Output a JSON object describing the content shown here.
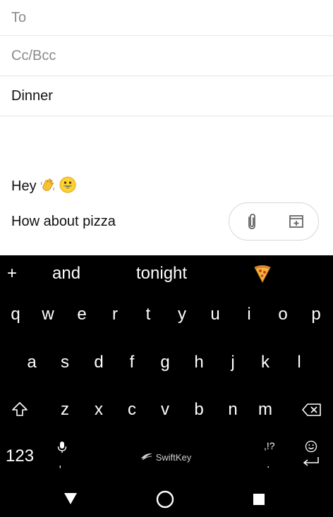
{
  "compose": {
    "to_placeholder": "To",
    "cc_placeholder": "Cc/Bcc",
    "subject": "Dinner",
    "body_line1": "Hey",
    "body_line2": "How about pizza"
  },
  "icons": {
    "wave": "waving-hand-emoji",
    "grin": "grinning-face-emoji",
    "attach": "paperclip-icon",
    "insert": "insert-box-icon",
    "pizza": "pizza-emoji"
  },
  "keyboard": {
    "plus": "+",
    "suggestions": [
      "and",
      "tonight"
    ],
    "row1": [
      "q",
      "w",
      "e",
      "r",
      "t",
      "y",
      "u",
      "i",
      "o",
      "p"
    ],
    "row2": [
      "a",
      "s",
      "d",
      "f",
      "g",
      "h",
      "j",
      "k",
      "l"
    ],
    "row3": [
      "z",
      "x",
      "c",
      "v",
      "b",
      "n",
      "m"
    ],
    "num_key": "123",
    "comma": ",",
    "space_brand": "SwiftKey",
    "punct": ",!?",
    "period": "."
  }
}
